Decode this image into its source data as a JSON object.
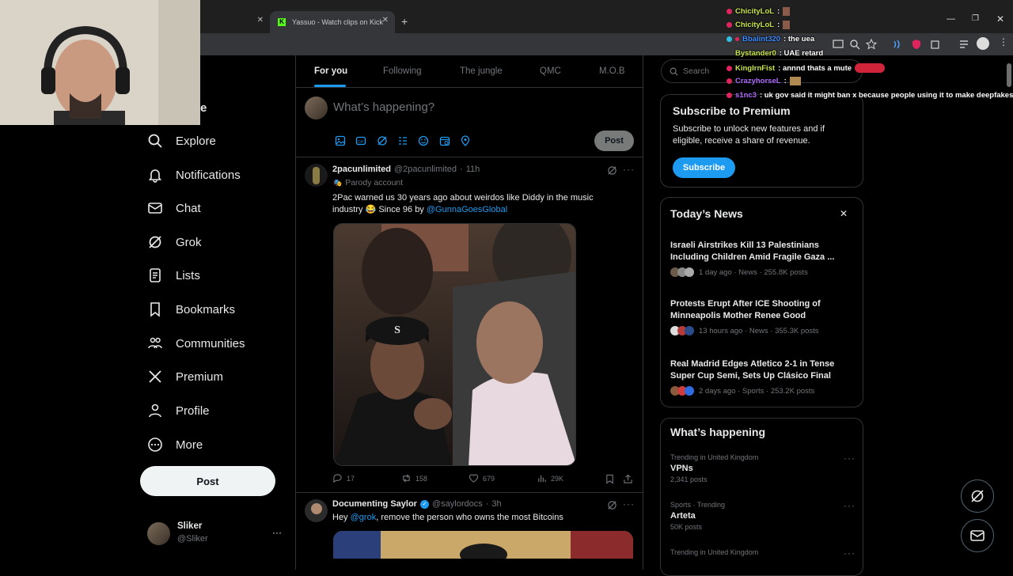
{
  "browser": {
    "tabs": [
      {
        "title": ""
      },
      {
        "title": "Yassuo - Watch clips on Kick"
      }
    ],
    "new_tab": "+"
  },
  "nav": {
    "home_partial": "e",
    "items": [
      {
        "label": "Explore",
        "icon": "search-icon"
      },
      {
        "label": "Notifications",
        "icon": "bell-icon"
      },
      {
        "label": "Chat",
        "icon": "mail-icon"
      },
      {
        "label": "Grok",
        "icon": "grok-icon"
      },
      {
        "label": "Lists",
        "icon": "list-icon"
      },
      {
        "label": "Bookmarks",
        "icon": "bookmark-icon"
      },
      {
        "label": "Communities",
        "icon": "communities-icon"
      },
      {
        "label": "Premium",
        "icon": "x-icon"
      },
      {
        "label": "Profile",
        "icon": "person-icon"
      },
      {
        "label": "More",
        "icon": "more-icon"
      }
    ],
    "post_button": "Post",
    "account": {
      "name": "Sliker",
      "handle": "@Sliker",
      "menu": "···"
    }
  },
  "feed": {
    "tabs": [
      "For you",
      "Following",
      "The jungle",
      "QMC",
      "M.O.B"
    ],
    "compose_placeholder": "What’s happening?",
    "compose_post": "Post",
    "tweets": [
      {
        "name": "2pacunlimited",
        "handle": "@2pacunlimited",
        "time": "11h",
        "label": "Parody account",
        "text": "2Pac warned us 30 years ago about weirdos like Diddy in the music industry 😂 Since 96 by",
        "mention": "@GunnaGoesGlobal",
        "replies": "17",
        "reposts": "158",
        "likes": "679",
        "views": "29K"
      },
      {
        "name": "Documenting Saylor",
        "handle": "@saylordocs",
        "time": "3h",
        "text_pre": "Hey",
        "mention": "@grok",
        "text_post": ", remove the person who owns the most Bitcoins"
      }
    ]
  },
  "search": {
    "placeholder": "Search"
  },
  "premium": {
    "title": "Subscribe to Premium",
    "body": "Subscribe to unlock new features and if eligible, receive a share of revenue.",
    "button": "Subscribe"
  },
  "news": {
    "title": "Today’s News",
    "close": "✕",
    "items": [
      {
        "headline": "Israeli Airstrikes Kill 13 Palestinians Including Children Amid Fragile Gaza ...",
        "meta": "1 day ago · News · 255.8K posts"
      },
      {
        "headline": "Protests Erupt After ICE Shooting of Minneapolis Mother Renee Good",
        "meta": "13 hours ago · News · 355.3K posts"
      },
      {
        "headline": "Real Madrid Edges Atletico 2-1 in Tense Super Cup Semi, Sets Up Clásico Final",
        "meta": "2 days ago · Sports · 253.2K posts"
      }
    ]
  },
  "happening": {
    "title": "What’s happening",
    "trends": [
      {
        "context": "Trending in United Kingdom",
        "name": "VPNs",
        "posts": "2,341 posts"
      },
      {
        "context": "Sports · Trending",
        "name": "Arteta",
        "posts": "50K posts"
      },
      {
        "context": "Trending in United Kingdom",
        "name": "",
        "posts": ""
      }
    ]
  },
  "chat": [
    {
      "user": "ChicityLoL",
      "msg": "",
      "color": "#c8e64a"
    },
    {
      "user": "ChicityLoL",
      "msg": "",
      "color": "#c8e64a"
    },
    {
      "user": "Bbalint320",
      "msg": ": the uea",
      "color": "#3b8cff"
    },
    {
      "user": "Bystander0",
      "msg": ": UAE retard",
      "color": "#c8e64a"
    },
    {
      "user": "KingIrnFist",
      "msg": ": annnd thats a mute",
      "color": "#c8e64a"
    },
    {
      "user": "CrazyhorseL",
      "msg": "",
      "color": "#b06bff"
    },
    {
      "user": "s1nc3",
      "msg": ": uk gov said it might ban x because people using it to make deepfakes",
      "color": "#b06bff"
    }
  ],
  "colors": {
    "accent": "#1d9bf0",
    "background": "#000000",
    "border": "#2f3336"
  }
}
